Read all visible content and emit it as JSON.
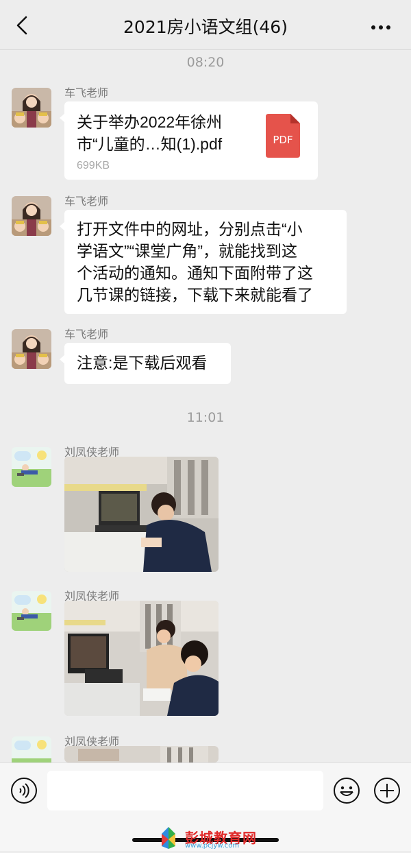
{
  "header": {
    "title": "2021房小语文组(46)",
    "back_icon": "chevron-left-icon",
    "more_icon": "ellipsis-icon"
  },
  "timestamps": [
    "08:20",
    "11:01"
  ],
  "messages": [
    {
      "sender": "车飞老师",
      "type": "file",
      "file_name": "关于举办2022年徐州市“儿童的…知(1).pdf",
      "file_name_line1": "关于举办2022年徐州",
      "file_name_line2": "市“儿童的…知(1).pdf",
      "file_size": "699KB",
      "file_icon_label": "PDF"
    },
    {
      "sender": "车飞老师",
      "type": "text",
      "lines": [
        "打开文件中的网址，分别点击“小",
        "学语文”“课堂广角”，就能找到这",
        "个活动的通知。通知下面附带了这",
        "几节课的链接，下载下来就能看了"
      ]
    },
    {
      "sender": "车飞老师",
      "type": "text",
      "lines": [
        "注意:是下载后观看"
      ]
    },
    {
      "sender": "刘凤侠老师",
      "type": "image"
    },
    {
      "sender": "刘凤侠老师",
      "type": "image"
    },
    {
      "sender": "刘凤侠老师",
      "type": "image"
    }
  ],
  "input_bar": {
    "voice_icon": "voice-icon",
    "emoji_icon": "emoji-icon",
    "plus_icon": "plus-icon"
  },
  "watermark": {
    "text": "彭城教育网",
    "url": "www.pcjyw.com"
  },
  "colors": {
    "background": "#ededed",
    "bubble": "#ffffff",
    "pdf_red": "#e5534b"
  }
}
